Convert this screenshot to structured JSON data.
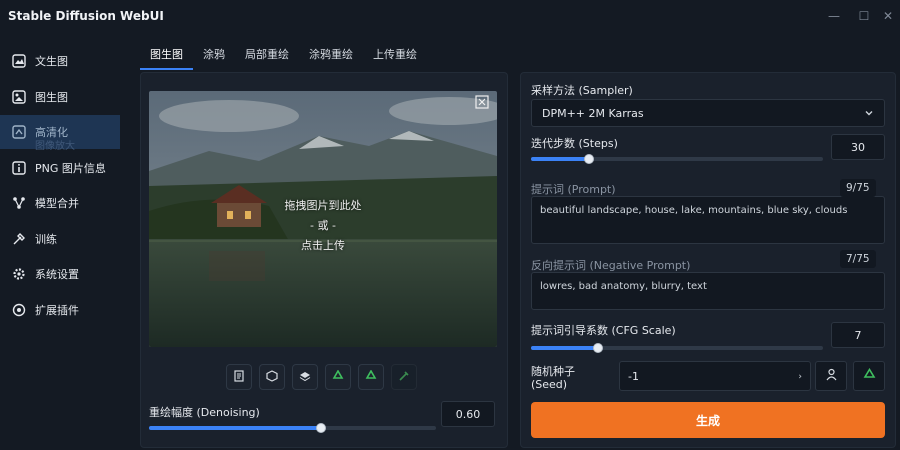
{
  "app": {
    "title": "Stable Diffusion WebUI"
  },
  "window_controls": {
    "minimize": "—",
    "maximize": "☐",
    "close": "✕"
  },
  "sidebar": {
    "items": [
      {
        "label": "文生图",
        "icon": "text-to-image-icon"
      },
      {
        "label": "图生图",
        "icon": "image-to-image-icon"
      },
      {
        "label": "高清化",
        "icon": "upscale-icon",
        "active": true,
        "ghost": "图像放大"
      },
      {
        "label": "PNG 图片信息",
        "icon": "info-icon"
      },
      {
        "label": "模型合并",
        "icon": "merge-icon"
      },
      {
        "label": "训练",
        "icon": "train-icon"
      },
      {
        "label": "系统设置",
        "icon": "gear-icon"
      },
      {
        "label": "扩展插件",
        "icon": "extension-icon"
      }
    ]
  },
  "tabs": [
    {
      "label": "图生图",
      "active": true
    },
    {
      "label": "涂鸦"
    },
    {
      "label": "局部重绘"
    },
    {
      "label": "涂鸦重绘"
    },
    {
      "label": "上传重绘"
    }
  ],
  "image_area": {
    "drop_line1": "拖拽图片到此处",
    "drop_line2": "- 或 -",
    "drop_line3": "点击上传"
  },
  "denoising": {
    "label": "重绘幅度 (Denoising)",
    "value": "0.60",
    "fraction": 0.6
  },
  "sampler": {
    "label": "采样方法 (Sampler)",
    "value": "DPM++ 2M Karras"
  },
  "steps": {
    "label": "迭代步数 (Steps)",
    "value": "30",
    "fraction": 0.2
  },
  "prompt": {
    "label": "提示词 (Prompt)",
    "counter": "9/75",
    "value": "beautiful landscape, house, lake, mountains, blue sky, clouds"
  },
  "negative_prompt": {
    "label": "反向提示词 (Negative Prompt)",
    "counter": "7/75",
    "value": "lowres, bad anatomy, blurry, text"
  },
  "cfg": {
    "label": "提示词引导系数 (CFG Scale)",
    "value": "7",
    "fraction": 0.23
  },
  "seed": {
    "label": "随机种子 (Seed)",
    "value": "-1"
  },
  "generate": {
    "label": "生成"
  },
  "colors": {
    "accent": "#3b82f6",
    "generate": "#f07222",
    "background": "#141a23"
  }
}
